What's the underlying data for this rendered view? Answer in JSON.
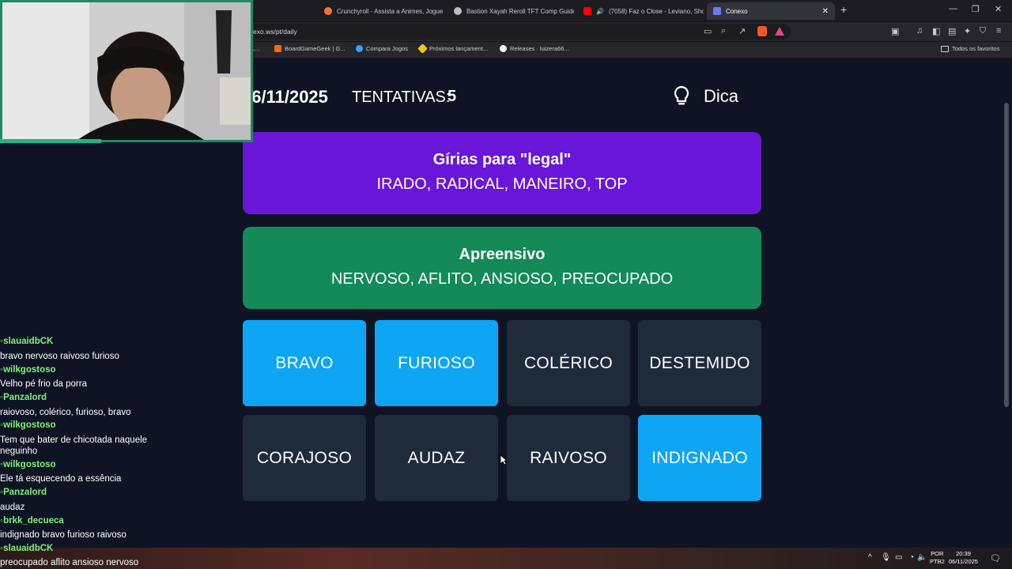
{
  "browser": {
    "tabs": [
      {
        "label": "Crunchyroll - Assista a Animes, Jogue",
        "color": "#f47521"
      },
      {
        "label": "Bastion Xayah Reroll TFT Comp Guide",
        "color": "#bbbbbb"
      },
      {
        "label": "(7058) Faz o Close - Leviano, Sho",
        "color": "#ff0000"
      },
      {
        "label": "Conexo",
        "color": "#6a7cf5"
      }
    ],
    "url": "exo.ws/pt/daily",
    "bookmarks": [
      {
        "label": "L...",
        "color": "#888888"
      },
      {
        "label": "BoardGameGeek | G...",
        "color": "#ff6a00"
      },
      {
        "label": "Compara Jogos",
        "color": "#3aa0ff"
      },
      {
        "label": "Próximos lançament...",
        "color": "#f5c518"
      },
      {
        "label": "Releases · luizera66...",
        "color": "#ffffff"
      }
    ],
    "favorites": "Todos os favoritos"
  },
  "game": {
    "date": "06/11/2025",
    "attempts_label": "TENTATIVAS:",
    "attempts_value": "5",
    "hint_label": "Dica",
    "groups": [
      {
        "title": "Gírias para \"legal\"",
        "words": "IRADO, RADICAL, MANEIRO, TOP",
        "color": "#6a16d9"
      },
      {
        "title": "Apreensivo",
        "words": "NERVOSO, AFLITO, ANSIOSO, PREOCUPADO",
        "color": "#138a57"
      }
    ],
    "tiles": [
      {
        "word": "BRAVO",
        "selected": true
      },
      {
        "word": "FURIOSO",
        "selected": true
      },
      {
        "word": "COLÉRICO",
        "selected": false
      },
      {
        "word": "DESTEMIDO",
        "selected": false
      },
      {
        "word": "CORAJOSO",
        "selected": false
      },
      {
        "word": "AUDAZ",
        "selected": false
      },
      {
        "word": "RAIVOSO",
        "selected": false
      },
      {
        "word": "INDIGNADO",
        "selected": true
      }
    ]
  },
  "chat": [
    {
      "user": "slauaidbCK",
      "message": "bravo nervoso raivoso furioso"
    },
    {
      "user": "wilkgostoso",
      "message": "Velho pé frio da porra"
    },
    {
      "user": "Panzalord",
      "message": "raiovoso, colérico, furioso, bravo"
    },
    {
      "user": "wilkgostoso",
      "message": "Tem que bater de chicotada naquele neguinho"
    },
    {
      "user": "wilkgostoso",
      "message": "Ele tá esquecendo a essência"
    },
    {
      "user": "Panzalord",
      "message": "audaz"
    },
    {
      "user": "brkk_decueca",
      "message": "indignado bravo furioso raivoso"
    },
    {
      "user": "slauaidbCK",
      "message": "preocupado aflito ansioso nervoso"
    }
  ],
  "taskbar": {
    "lang_top": "POR",
    "lang_bottom": "PTB2",
    "time": "20:39",
    "date": "06/11/2025"
  }
}
